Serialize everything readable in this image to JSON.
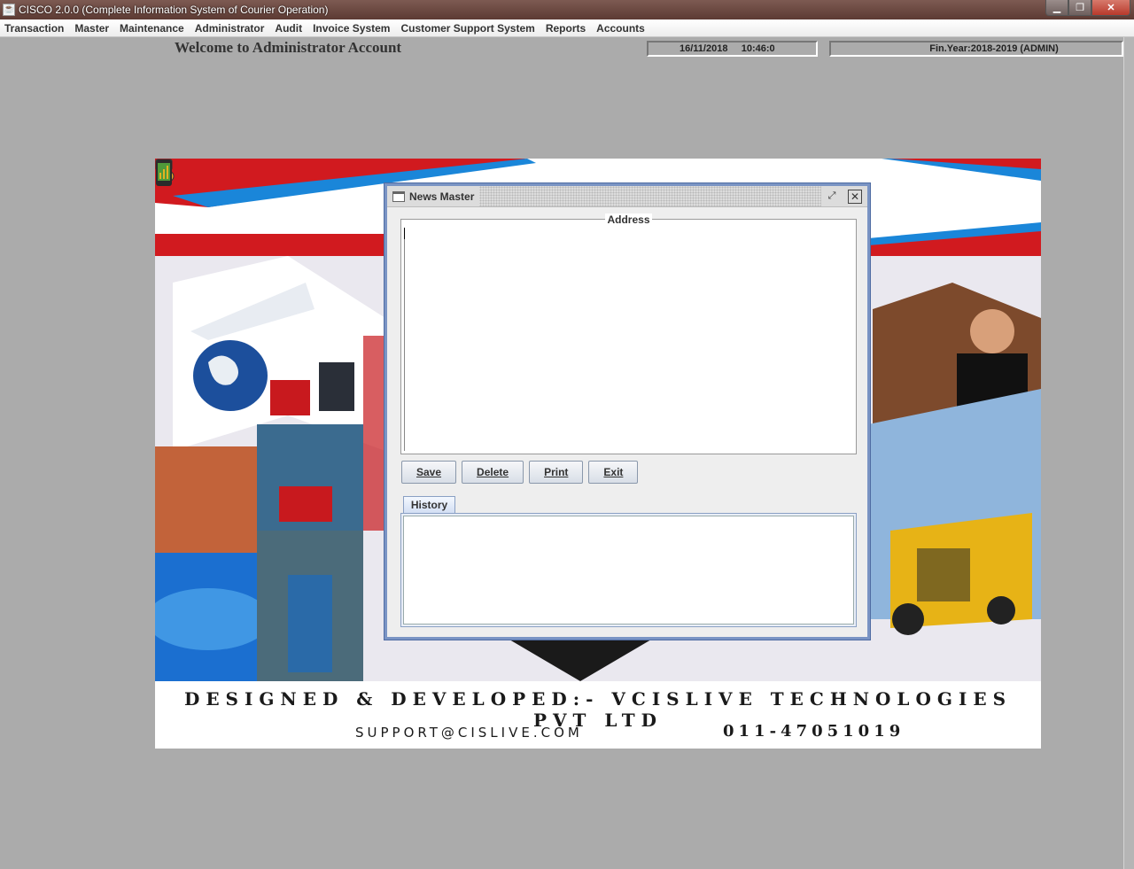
{
  "window": {
    "title": "CISCO 2.0.0 (Complete Information System of Courier Operation)"
  },
  "menubar": {
    "items": [
      {
        "label": "Transaction"
      },
      {
        "label": "Master"
      },
      {
        "label": "Maintenance"
      },
      {
        "label": "Administrator"
      },
      {
        "label": "Audit"
      },
      {
        "label": "Invoice System"
      },
      {
        "label": "Customer Support System"
      },
      {
        "label": "Reports"
      },
      {
        "label": "Accounts"
      }
    ]
  },
  "header": {
    "welcome": "Welcome to Administrator Account",
    "date": "16/11/2018",
    "time": "10:46:0",
    "fin_year": "Fin.Year:2018-2019  (ADMIN)"
  },
  "banner": {
    "designed_by": "DESIGNED & DEVELOPED:- VCISLIVE TECHNOLOGIES PVT LTD",
    "email": "SUPPORT@CISLIVE.COM",
    "phone": "011-47051019",
    "colors": {
      "red": "#d11a1f",
      "blue": "#1a86d9"
    }
  },
  "news_master": {
    "title": "News Master",
    "address_legend": "Address",
    "address_value": "",
    "buttons": {
      "save": "Save",
      "delete": "Delete",
      "print": "Print",
      "exit": "Exit"
    },
    "history_tab": "History",
    "frame_border_color": "#7a94c4"
  }
}
